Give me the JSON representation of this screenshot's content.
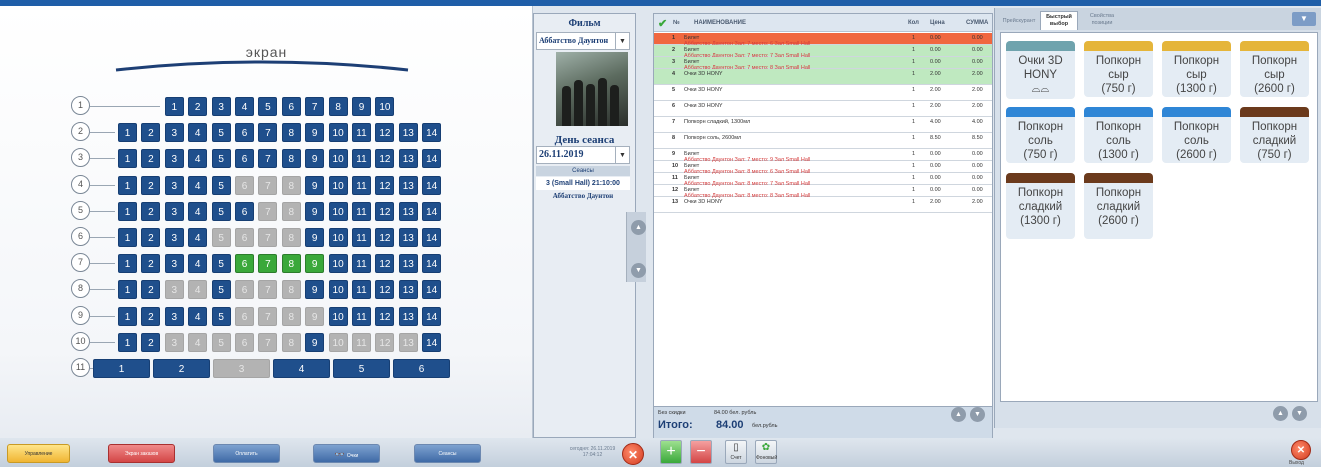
{
  "hall": {
    "screen_label": "экран",
    "rows": [
      {
        "label": "1",
        "seats": [
          {
            "n": "1"
          },
          {
            "n": "2"
          },
          {
            "n": "3"
          },
          {
            "n": "4"
          },
          {
            "n": "5"
          },
          {
            "n": "6"
          },
          {
            "n": "7"
          },
          {
            "n": "8"
          },
          {
            "n": "9"
          },
          {
            "n": "10"
          }
        ]
      },
      {
        "label": "2",
        "seats": [
          {
            "n": "1"
          },
          {
            "n": "2"
          },
          {
            "n": "3"
          },
          {
            "n": "4"
          },
          {
            "n": "5"
          },
          {
            "n": "6"
          },
          {
            "n": "7"
          },
          {
            "n": "8"
          },
          {
            "n": "9"
          },
          {
            "n": "10"
          },
          {
            "n": "11"
          },
          {
            "n": "12"
          },
          {
            "n": "13"
          },
          {
            "n": "14"
          }
        ]
      },
      {
        "label": "3",
        "seats": [
          {
            "n": "1"
          },
          {
            "n": "2"
          },
          {
            "n": "3"
          },
          {
            "n": "4"
          },
          {
            "n": "5"
          },
          {
            "n": "6"
          },
          {
            "n": "7"
          },
          {
            "n": "8"
          },
          {
            "n": "9"
          },
          {
            "n": "10"
          },
          {
            "n": "11"
          },
          {
            "n": "12"
          },
          {
            "n": "13"
          },
          {
            "n": "14"
          }
        ]
      },
      {
        "label": "4",
        "seats": [
          {
            "n": "1"
          },
          {
            "n": "2"
          },
          {
            "n": "3"
          },
          {
            "n": "4"
          },
          {
            "n": "5"
          },
          {
            "n": "6",
            "st": "o"
          },
          {
            "n": "7",
            "st": "o"
          },
          {
            "n": "8",
            "st": "o"
          },
          {
            "n": "9"
          },
          {
            "n": "10"
          },
          {
            "n": "11"
          },
          {
            "n": "12"
          },
          {
            "n": "13"
          },
          {
            "n": "14"
          }
        ]
      },
      {
        "label": "5",
        "seats": [
          {
            "n": "1"
          },
          {
            "n": "2"
          },
          {
            "n": "3"
          },
          {
            "n": "4"
          },
          {
            "n": "5"
          },
          {
            "n": "6"
          },
          {
            "n": "7",
            "st": "o"
          },
          {
            "n": "8",
            "st": "o"
          },
          {
            "n": "9"
          },
          {
            "n": "10"
          },
          {
            "n": "11"
          },
          {
            "n": "12"
          },
          {
            "n": "13"
          },
          {
            "n": "14"
          }
        ]
      },
      {
        "label": "6",
        "seats": [
          {
            "n": "1"
          },
          {
            "n": "2"
          },
          {
            "n": "3"
          },
          {
            "n": "4"
          },
          {
            "n": "5",
            "st": "o"
          },
          {
            "n": "6",
            "st": "o"
          },
          {
            "n": "7",
            "st": "o"
          },
          {
            "n": "8",
            "st": "o"
          },
          {
            "n": "9"
          },
          {
            "n": "10"
          },
          {
            "n": "11"
          },
          {
            "n": "12"
          },
          {
            "n": "13"
          },
          {
            "n": "14"
          }
        ]
      },
      {
        "label": "7",
        "seats": [
          {
            "n": "1"
          },
          {
            "n": "2"
          },
          {
            "n": "3"
          },
          {
            "n": "4"
          },
          {
            "n": "5"
          },
          {
            "n": "6",
            "st": "s"
          },
          {
            "n": "7",
            "st": "s"
          },
          {
            "n": "8",
            "st": "s"
          },
          {
            "n": "9",
            "st": "s"
          },
          {
            "n": "10"
          },
          {
            "n": "11"
          },
          {
            "n": "12"
          },
          {
            "n": "13"
          },
          {
            "n": "14"
          }
        ]
      },
      {
        "label": "8",
        "seats": [
          {
            "n": "1"
          },
          {
            "n": "2"
          },
          {
            "n": "3",
            "st": "o"
          },
          {
            "n": "4",
            "st": "o"
          },
          {
            "n": "5"
          },
          {
            "n": "6",
            "st": "o"
          },
          {
            "n": "7",
            "st": "o"
          },
          {
            "n": "8",
            "st": "o"
          },
          {
            "n": "9"
          },
          {
            "n": "10"
          },
          {
            "n": "11"
          },
          {
            "n": "12"
          },
          {
            "n": "13"
          },
          {
            "n": "14"
          }
        ]
      },
      {
        "label": "9",
        "seats": [
          {
            "n": "1"
          },
          {
            "n": "2"
          },
          {
            "n": "3"
          },
          {
            "n": "4"
          },
          {
            "n": "5"
          },
          {
            "n": "6",
            "st": "o"
          },
          {
            "n": "7",
            "st": "o"
          },
          {
            "n": "8",
            "st": "o"
          },
          {
            "n": "9",
            "st": "o"
          },
          {
            "n": "10"
          },
          {
            "n": "11"
          },
          {
            "n": "12"
          },
          {
            "n": "13"
          },
          {
            "n": "14"
          }
        ]
      },
      {
        "label": "10",
        "seats": [
          {
            "n": "1"
          },
          {
            "n": "2"
          },
          {
            "n": "3",
            "st": "o"
          },
          {
            "n": "4",
            "st": "o"
          },
          {
            "n": "5",
            "st": "o"
          },
          {
            "n": "6",
            "st": "o"
          },
          {
            "n": "7",
            "st": "o"
          },
          {
            "n": "8",
            "st": "o"
          },
          {
            "n": "9"
          },
          {
            "n": "10",
            "st": "o"
          },
          {
            "n": "11",
            "st": "o"
          },
          {
            "n": "12",
            "st": "o"
          },
          {
            "n": "13",
            "st": "o"
          },
          {
            "n": "14"
          }
        ]
      },
      {
        "label": "11",
        "seats": [
          {
            "n": "1",
            "wide": true
          },
          {
            "n": "2",
            "wide": true
          },
          {
            "n": "3",
            "wide": true,
            "st": "o"
          },
          {
            "n": "4",
            "wide": true
          },
          {
            "n": "5",
            "wide": true
          },
          {
            "n": "6",
            "wide": true
          }
        ]
      }
    ]
  },
  "film_panel": {
    "header": "Фильм",
    "film_select": "Аббатство Даунтон",
    "session_day_label": "День сеанса",
    "date_value": "26.11.2019",
    "sessions_header": "Сеансы",
    "session_item": "3 (Small Hall) 21:10:00",
    "session_film": "Аббатство Даунтон"
  },
  "order": {
    "columns": {
      "num": "№",
      "name": "НАИМЕНОВАНИЕ",
      "qty": "Кол",
      "price": "Цена",
      "total": "СУММА"
    },
    "rows": [
      {
        "n": "1",
        "name": "Билет",
        "sub": "Аббатство Даунтон Зал: 7 место: 6 Зал Small Hall",
        "qty": "1",
        "price": "0.00",
        "total": "0.00",
        "hl": "red"
      },
      {
        "n": "2",
        "name": "Билет",
        "sub": "Аббатство Даунтон Зал: 7 место: 7 Зал Small Hall",
        "qty": "1",
        "price": "0.00",
        "total": "0.00",
        "hl": "green"
      },
      {
        "n": "3",
        "name": "Билет",
        "sub": "Аббатство Даунтон Зал: 7 место: 8 Зал Small Hall",
        "qty": "1",
        "price": "0.00",
        "total": "0.00",
        "hl": "green"
      },
      {
        "n": "4",
        "name": "Очки 3D HONY",
        "sub": "",
        "qty": "1",
        "price": "2.00",
        "total": "2.00",
        "hl": "green"
      },
      {
        "n": "5",
        "name": "Очки 3D HONY",
        "sub": "",
        "qty": "1",
        "price": "2.00",
        "total": "2.00",
        "hl": ""
      },
      {
        "n": "6",
        "name": "Очки 3D HONY",
        "sub": "",
        "qty": "1",
        "price": "2.00",
        "total": "2.00",
        "hl": ""
      },
      {
        "n": "7",
        "name": "Попкорн сладкий, 1300мл",
        "sub": "",
        "qty": "1",
        "price": "4.00",
        "total": "4.00",
        "hl": ""
      },
      {
        "n": "8",
        "name": "Попкорн соль, 2600мл",
        "sub": "",
        "qty": "1",
        "price": "8.50",
        "total": "8.50",
        "hl": ""
      },
      {
        "n": "9",
        "name": "Билет",
        "sub": "Аббатство Даунтон Зал: 7 место: 9 Зал Small Hall",
        "qty": "1",
        "price": "0.00",
        "total": "0.00",
        "hl": ""
      },
      {
        "n": "10",
        "name": "Билет",
        "sub": "Аббатство Даунтон Зал: 8 место: 6 Зал Small Hall",
        "qty": "1",
        "price": "0.00",
        "total": "0.00",
        "hl": ""
      },
      {
        "n": "11",
        "name": "Билет",
        "sub": "Аббатство Даунтон Зал: 8 место: 7 Зал Small Hall",
        "qty": "1",
        "price": "0.00",
        "total": "0.00",
        "hl": ""
      },
      {
        "n": "12",
        "name": "Билет",
        "sub": "Аббатство Даунтон Зал: 8 место: 8 Зал Small Hall",
        "qty": "1",
        "price": "0.00",
        "total": "0.00",
        "hl": ""
      },
      {
        "n": "13",
        "name": "Очки 3D HONY",
        "sub": "",
        "qty": "1",
        "price": "2.00",
        "total": "2.00",
        "hl": ""
      }
    ],
    "summary_label": "Без скидки",
    "summary_value": "84.00 бел. рубль",
    "total_label": "Итого:",
    "total_value": "84.00",
    "total_unit": "бел.рубль"
  },
  "products": {
    "tabs": [
      "Прейскурант",
      "Быстрый выбор",
      "Свойства позиции"
    ],
    "active_tab": 1,
    "items": [
      {
        "lines": [
          "Очки 3D",
          "HONY"
        ],
        "color": "#6fa3ad",
        "icon": "3d-glasses-icon"
      },
      {
        "lines": [
          "Попкорн",
          "сыр",
          "(750 г)"
        ],
        "color": "#e5b53a"
      },
      {
        "lines": [
          "Попкорн",
          "сыр",
          "(1300 г)"
        ],
        "color": "#e5b53a"
      },
      {
        "lines": [
          "Попкорн",
          "сыр",
          "(2600 г)"
        ],
        "color": "#e5b53a"
      },
      {
        "lines": [
          "Попкорн",
          "соль",
          "(750 г)"
        ],
        "color": "#2f86d6"
      },
      {
        "lines": [
          "Попкорн",
          "соль",
          "(1300 г)"
        ],
        "color": "#2f86d6"
      },
      {
        "lines": [
          "Попкорн",
          "соль",
          "(2600 г)"
        ],
        "color": "#2f86d6"
      },
      {
        "lines": [
          "Попкорн",
          "сладкий",
          "(750 г)"
        ],
        "color": "#6b3a1c"
      },
      {
        "lines": [
          "Попкорн",
          "сладкий",
          "(1300 г)"
        ],
        "color": "#6b3a1c"
      },
      {
        "lines": [
          "Попкорн",
          "сладкий",
          "(2600 г)"
        ],
        "color": "#6b3a1c"
      }
    ]
  },
  "bottom": {
    "manage_label": "Управление",
    "cancel_label": "Экран заказов",
    "pay_label": "Оплатить",
    "glasses_label": "Очки",
    "sessions_label": "Сеансы",
    "date_time": "сегодня: 26.11.2019",
    "time": "17:04:12",
    "check_label": "Счет",
    "plants_label": "Фоновый",
    "exit_label": "Выход"
  }
}
